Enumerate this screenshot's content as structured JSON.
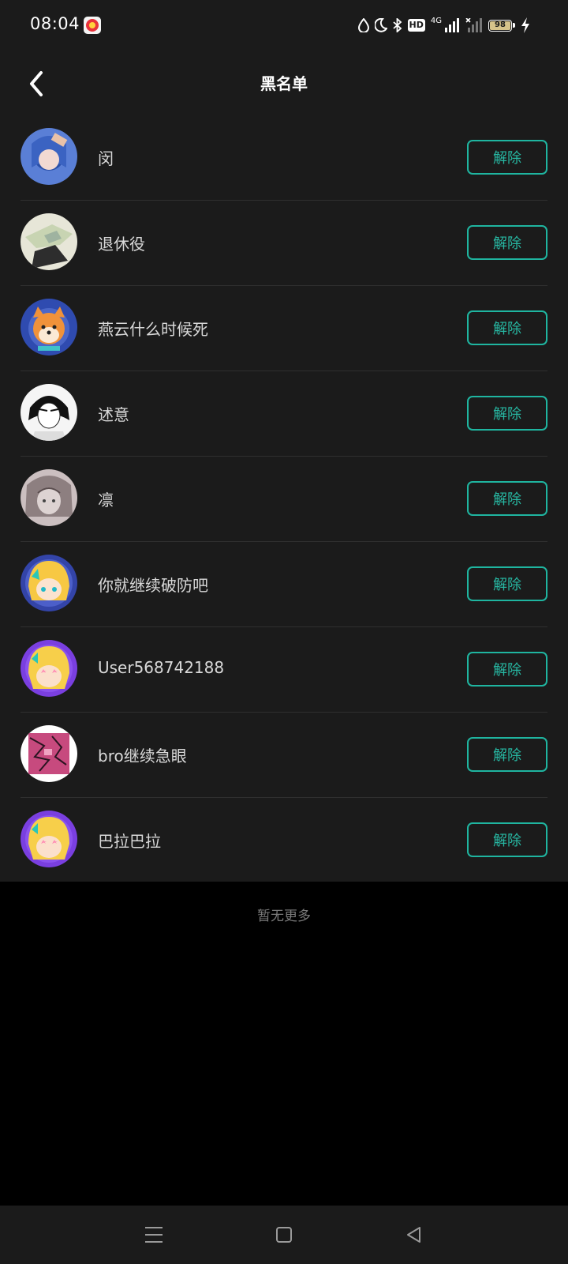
{
  "status_bar": {
    "time": "08:04",
    "network_label": "4G",
    "hd_label": "HD",
    "battery_level": "98",
    "icons": [
      "water-drop-icon",
      "moon-icon",
      "bluetooth-icon",
      "hd-icon",
      "signal-icon",
      "signal-muted-icon",
      "battery-icon",
      "charging-icon"
    ]
  },
  "header": {
    "title": "黑名单",
    "back_icon": "back-chevron-icon"
  },
  "blocklist": {
    "action_label": "解除",
    "users": [
      {
        "name": "闵",
        "avatar": "anime-blue-hair"
      },
      {
        "name": "退休役",
        "avatar": "sketch-figure"
      },
      {
        "name": "燕云什么时候死",
        "avatar": "shiba-dog"
      },
      {
        "name": "述意",
        "avatar": "manga-boy"
      },
      {
        "name": "凛",
        "avatar": "gray-sketch-girl"
      },
      {
        "name": "你就继续破防吧",
        "avatar": "yellow-hair-girl"
      },
      {
        "name": "User568742188",
        "avatar": "star-eyes-girl"
      },
      {
        "name": "bro继续急眼",
        "avatar": "pink-noise"
      },
      {
        "name": "巴拉巴拉",
        "avatar": "star-eyes-girl"
      }
    ]
  },
  "footer": {
    "no_more_text": "暂无更多"
  },
  "nav_bar": {
    "buttons": [
      "menu-icon",
      "home-square-icon",
      "back-triangle-icon"
    ]
  },
  "colors": {
    "accent": "#1fb5a0",
    "surface": "#1b1b1b",
    "background": "#000000"
  }
}
